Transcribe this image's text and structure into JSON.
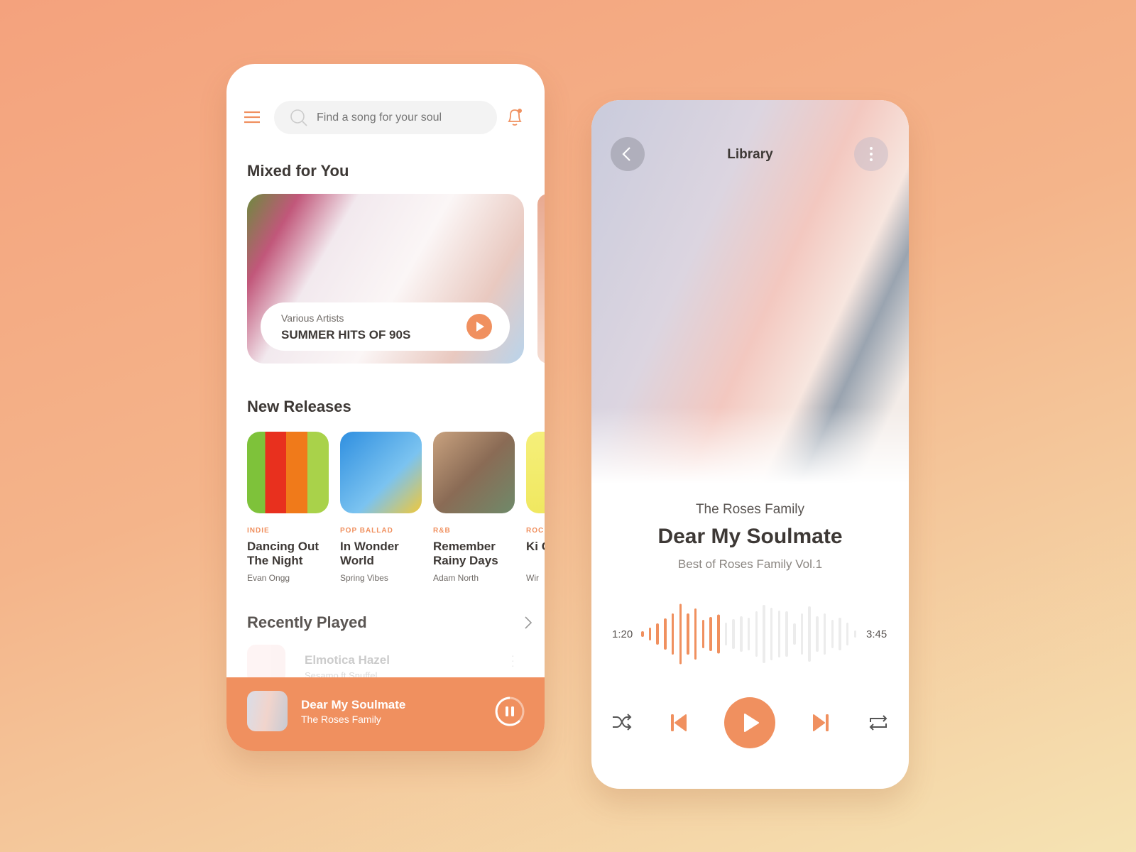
{
  "colors": {
    "accent": "#F0905F",
    "text": "#3D3835",
    "muted": "#8A8580"
  },
  "home": {
    "menu_icon": "hamburger-icon",
    "search": {
      "placeholder": "Find a song for your soul",
      "icon": "search-icon"
    },
    "notification_icon": "bell-icon",
    "mixed_title": "Mixed for You",
    "featured": {
      "subtitle": "Various Artists",
      "title": "SUMMER HITS OF 90S"
    },
    "new_releases_title": "New Releases",
    "releases": [
      {
        "genre": "INDIE",
        "title": "Dancing Out The Night",
        "artist": "Evan Ongg"
      },
      {
        "genre": "POP BALLAD",
        "title": "In Wonder World",
        "artist": "Spring Vibes"
      },
      {
        "genre": "R&B",
        "title": "Remember Rainy Days",
        "artist": "Adam North"
      },
      {
        "genre": "ROC",
        "title": "Ki Go",
        "artist": "Wir"
      }
    ],
    "recent_title": "Recently Played",
    "recent": [
      {
        "title": "Elmotica Hazel",
        "artist": "Sesamo ft Snuffel"
      }
    ],
    "mini_player": {
      "title": "Dear My Soulmate",
      "artist": "The Roses Family",
      "state": "playing"
    }
  },
  "player": {
    "header": "Library",
    "artist": "The Roses Family",
    "title": "Dear My Soulmate",
    "album": "Best of Roses Family Vol.1",
    "elapsed": "1:20",
    "duration": "3:45",
    "progress": 0.36,
    "waveform": [
      8,
      18,
      30,
      44,
      58,
      85,
      58,
      72,
      40,
      48,
      55,
      32,
      42,
      50,
      46,
      64,
      82,
      74,
      66,
      64,
      30,
      58,
      78,
      50,
      58,
      40,
      46,
      32,
      10
    ]
  }
}
